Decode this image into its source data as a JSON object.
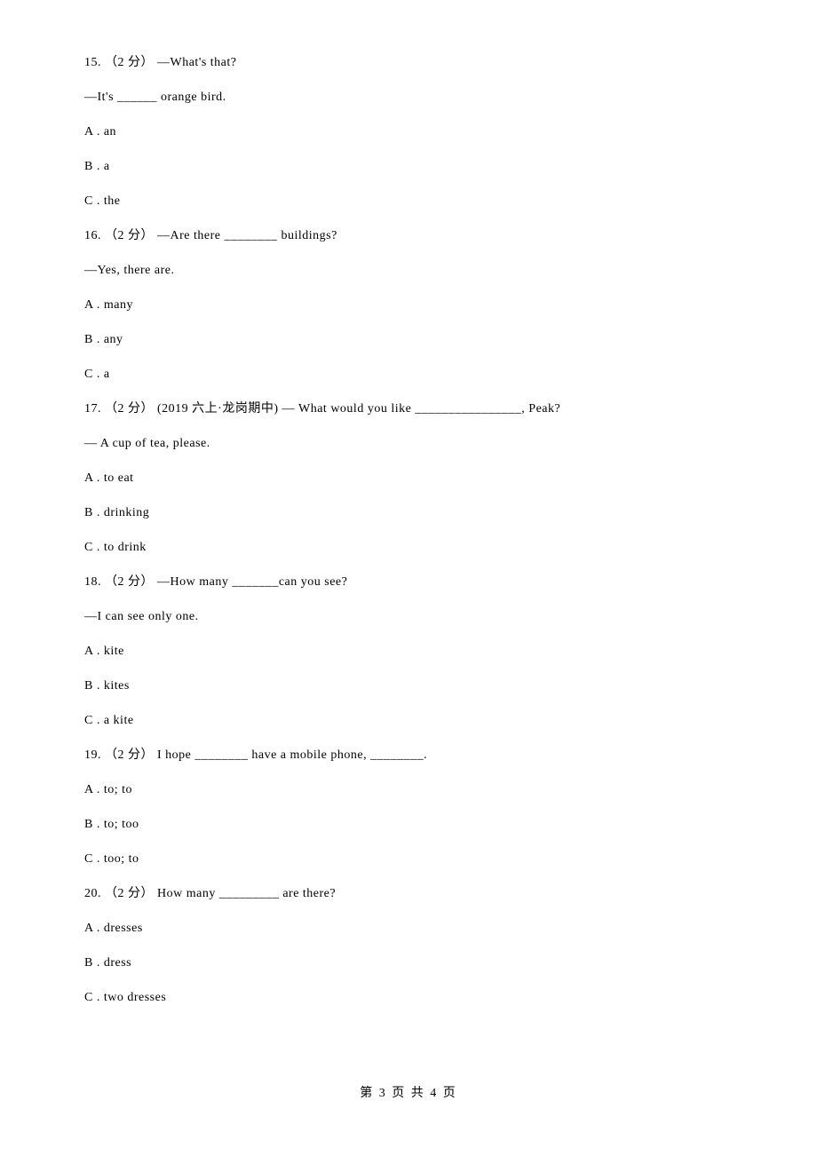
{
  "questions": [
    {
      "num": "15.",
      "points": "（2 分）",
      "stem1": " —What's that?",
      "stem2": "—It's ______ orange bird.",
      "opts": {
        "a": "A . an",
        "b": "B . a",
        "c": "C . the"
      }
    },
    {
      "num": "16.",
      "points": "（2 分）",
      "stem1": " —Are there ________ buildings?",
      "stem2": "—Yes, there are.",
      "opts": {
        "a": "A . many",
        "b": "B . any",
        "c": "C . a"
      }
    },
    {
      "num": "17.",
      "points": "（2 分）",
      "source": " (2019 六上·龙岗期中) ",
      "stem1": "— What would you like ________________, Peak?",
      "stem2": "— A cup of tea, please.",
      "opts": {
        "a": "A . to eat",
        "b": "B . drinking",
        "c": "C . to drink"
      }
    },
    {
      "num": "18.",
      "points": "（2 分）",
      "stem1": " —How many _______can you see?",
      "stem2": "—I can see only one.",
      "opts": {
        "a": "A . kite",
        "b": "B . kites",
        "c": "C . a kite"
      }
    },
    {
      "num": "19.",
      "points": "（2 分）",
      "stem1": " I hope ________ have a mobile phone, ________.",
      "opts": {
        "a": "A . to; to",
        "b": "B . to; too",
        "c": "C . too; to"
      }
    },
    {
      "num": "20.",
      "points": "（2 分）",
      "stem1": " How many _________ are there?",
      "opts": {
        "a": "A . dresses",
        "b": "B . dress",
        "c": "C . two dresses"
      }
    }
  ],
  "footer": "第 3 页 共 4 页"
}
